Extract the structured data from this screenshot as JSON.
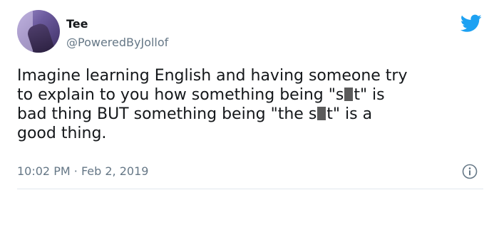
{
  "user": {
    "display_name": "Tee",
    "handle": "@PoweredByJollof"
  },
  "tweet": {
    "line1": "Imagine learning English and having someone try",
    "line2_a": "to explain to you how something being \"s",
    "line2_b": "t\" is",
    "line3_a": "bad thing BUT something being \"the s",
    "line3_b": "t\" is a",
    "line4": "good thing."
  },
  "meta": {
    "time": "10:02 PM",
    "separator": "·",
    "date": "Feb 2, 2019"
  },
  "icons": {
    "brand": "twitter-bird-icon",
    "info": "info-icon"
  },
  "colors": {
    "brand": "#1da1f2",
    "text": "#14171a",
    "muted": "#657786",
    "redaction": "#5b5b5b"
  }
}
